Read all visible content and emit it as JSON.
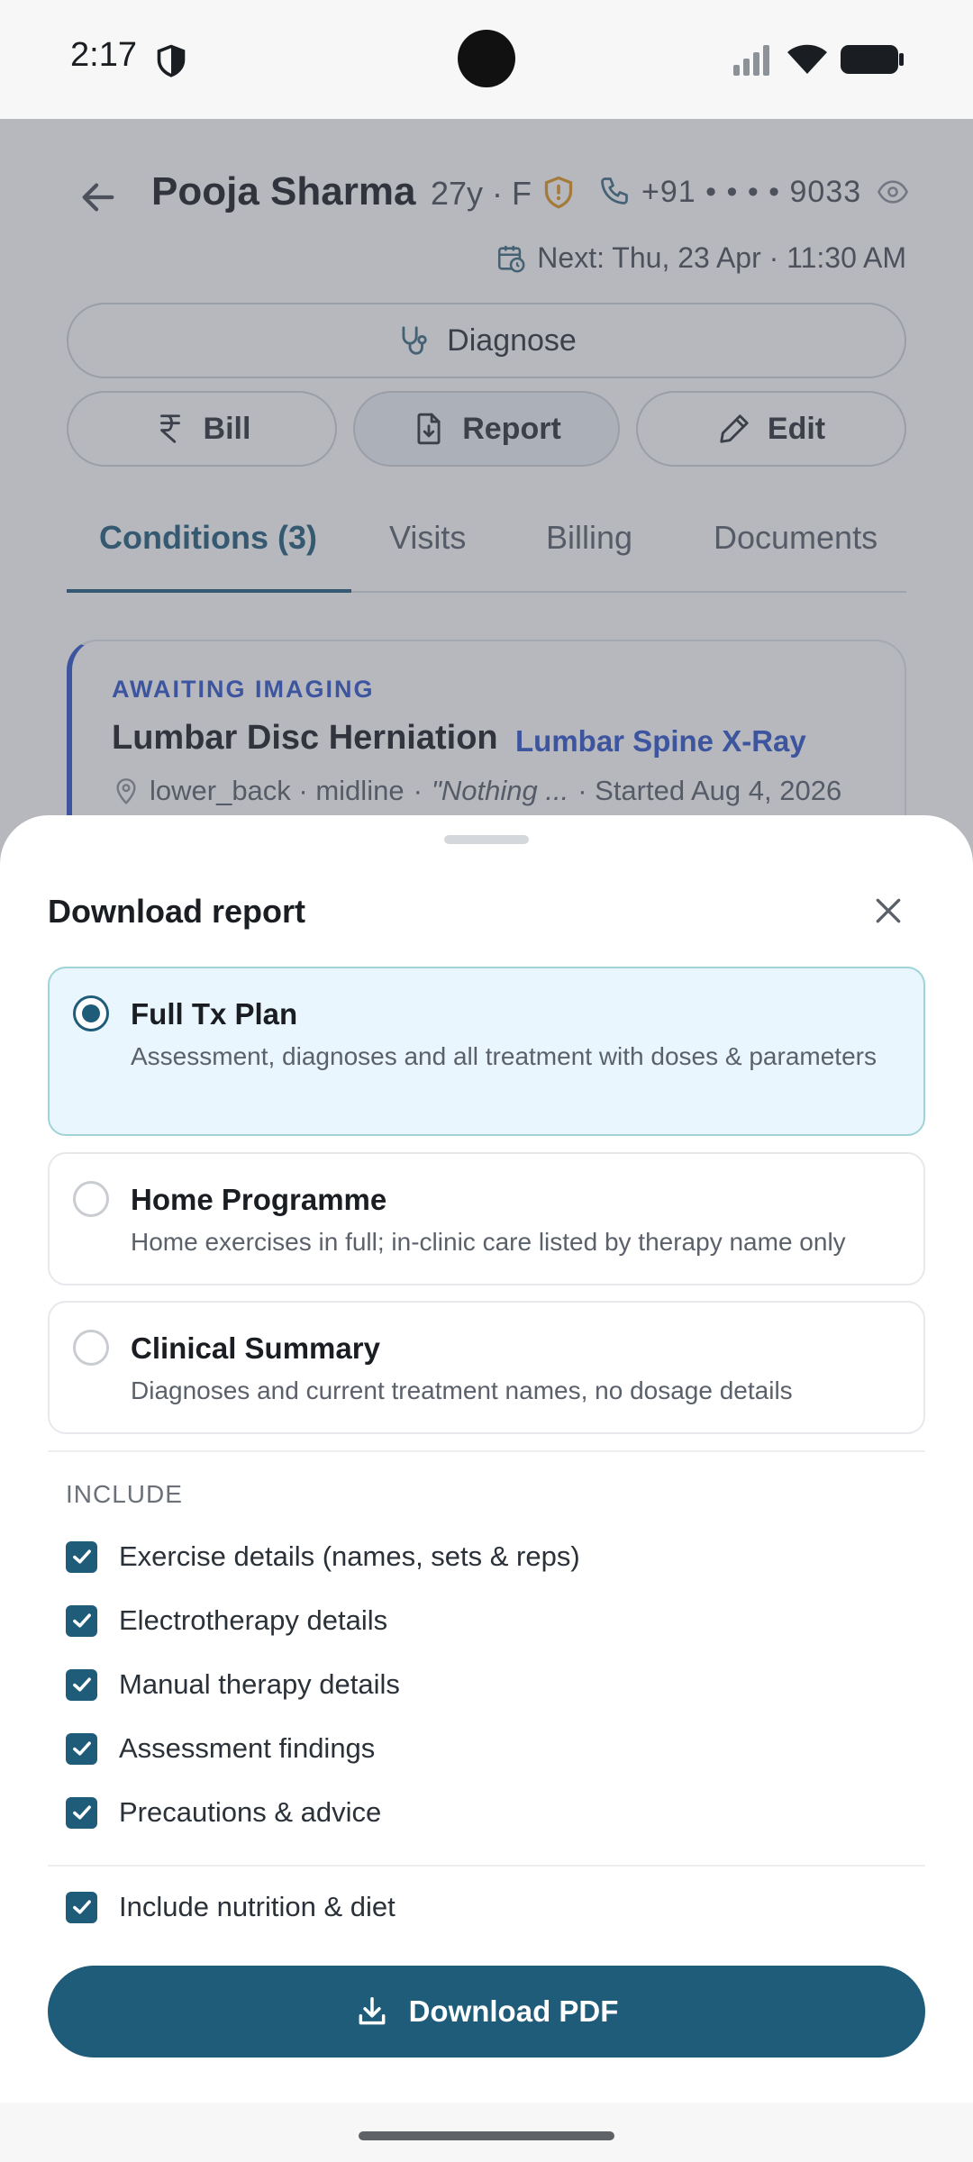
{
  "status_bar": {
    "time": "2:17",
    "icons": [
      "shield-icon",
      "signal-icon",
      "wifi-icon",
      "battery-icon"
    ]
  },
  "patient": {
    "name": "Pooja Sharma",
    "age_sex": "27y · F",
    "phone": "+91  • • • •  9033",
    "next_appointment": "Next: Thu, 23 Apr · 11:30 AM"
  },
  "actions": {
    "diagnose_label": "Diagnose",
    "bill_label": "Bill",
    "report_label": "Report",
    "edit_label": "Edit"
  },
  "tabs": [
    {
      "label": "Conditions (3)",
      "active": true
    },
    {
      "label": "Visits",
      "active": false
    },
    {
      "label": "Billing",
      "active": false
    },
    {
      "label": "Documents",
      "active": false
    }
  ],
  "condition_card": {
    "status": "AWAITING IMAGING",
    "title": "Lumbar Disc Herniation",
    "linked_test": "Lumbar Spine X-Ray",
    "location": "lower_back · midline",
    "note": "\"Nothing ...",
    "started": "· Started Aug 4, 2026"
  },
  "sheet": {
    "title": "Download report",
    "options": [
      {
        "title": "Full Tx Plan",
        "description": "Assessment, diagnoses and all treatment with doses & parameters",
        "selected": true
      },
      {
        "title": "Home Programme",
        "description": "Home exercises in full; in-clinic care listed by therapy name only",
        "selected": false
      },
      {
        "title": "Clinical Summary",
        "description": "Diagnoses and current treatment names, no dosage details",
        "selected": false
      }
    ],
    "include_label": "INCLUDE",
    "include_items": [
      {
        "label": "Exercise details (names, sets & reps)",
        "checked": true
      },
      {
        "label": "Electrotherapy details",
        "checked": true
      },
      {
        "label": "Manual therapy details",
        "checked": true
      },
      {
        "label": "Assessment findings",
        "checked": true
      },
      {
        "label": "Precautions & advice",
        "checked": true
      }
    ],
    "nutrition": {
      "label": "Include nutrition & diet",
      "checked": true
    },
    "download_label": "Download PDF"
  },
  "colors": {
    "primary": "#1f5c7a",
    "accent_blue": "#2d55c8",
    "selected_bg": "#e9f6fd",
    "warning_orange": "#e0961e"
  }
}
